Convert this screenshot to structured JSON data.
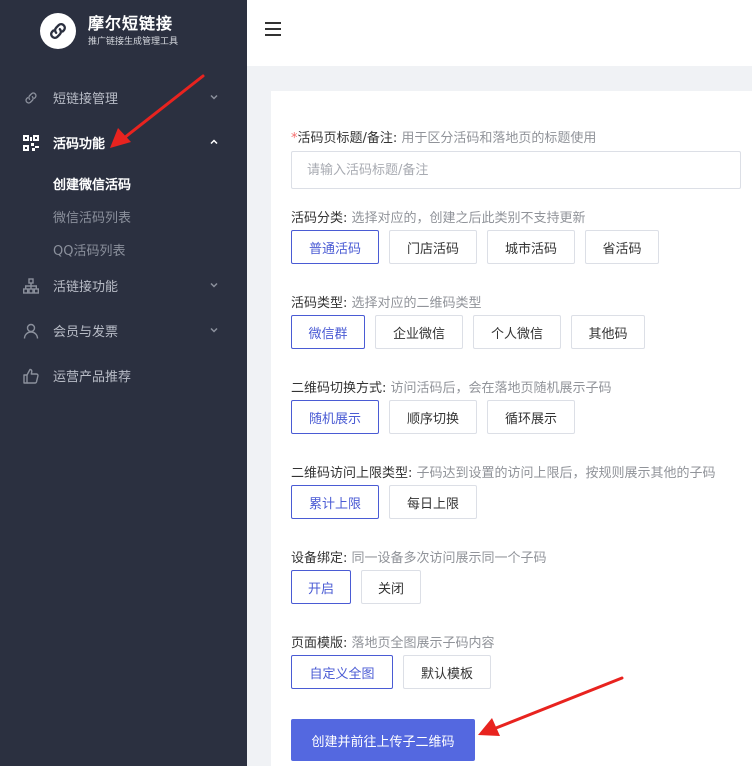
{
  "brand": {
    "title": "摩尔短链接",
    "subtitle": "推广链接生成管理工具"
  },
  "sidebar": {
    "items": [
      {
        "label": "短链接管理",
        "icon": "link-icon"
      },
      {
        "label": "活码功能",
        "icon": "qrcode-icon"
      },
      {
        "label": "活链接功能",
        "icon": "sitemap-icon"
      },
      {
        "label": "会员与发票",
        "icon": "user-icon"
      },
      {
        "label": "运营产品推荐",
        "icon": "thumbs-up-icon"
      }
    ],
    "sub_items": [
      "创建微信活码",
      "微信活码列表",
      "QQ活码列表"
    ]
  },
  "form": {
    "title_field": {
      "required_mark": "*",
      "label": "活码页标题/备注:",
      "hint": " 用于区分活码和落地页的标题使用",
      "placeholder": "请输入活码标题/备注"
    },
    "category": {
      "label": "活码分类:",
      "hint": " 选择对应的，创建之后此类别不支持更新",
      "options": [
        "普通活码",
        "门店活码",
        "城市活码",
        "省活码"
      ]
    },
    "type": {
      "label": "活码类型:",
      "hint": " 选择对应的二维码类型",
      "options": [
        "微信群",
        "企业微信",
        "个人微信",
        "其他码"
      ]
    },
    "switch_mode": {
      "label": "二维码切换方式:",
      "hint": " 访问活码后，会在落地页随机展示子码",
      "options": [
        "随机展示",
        "顺序切换",
        "循环展示"
      ]
    },
    "limit_type": {
      "label": "二维码访问上限类型:",
      "hint": " 子码达到设置的访问上限后，按规则展示其他的子码",
      "options": [
        "累计上限",
        "每日上限"
      ]
    },
    "device_bind": {
      "label": "设备绑定:",
      "hint": " 同一设备多次访问展示同一个子码",
      "options": [
        "开启",
        "关闭"
      ]
    },
    "template": {
      "label": "页面模版:",
      "hint": " 落地页全图展示子码内容",
      "options": [
        "自定义全图",
        "默认模板"
      ]
    },
    "submit_label": "创建并前往上传子二维码"
  },
  "colors": {
    "sidebar_bg": "#2b3040",
    "accent": "#4a5bd4",
    "button": "#5468e0",
    "arrow": "#e8231f"
  }
}
